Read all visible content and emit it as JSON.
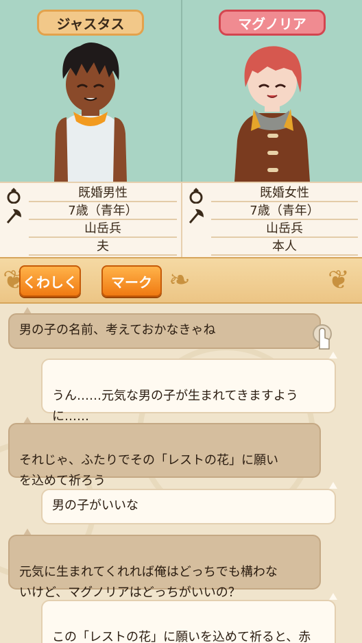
{
  "characters": {
    "left": {
      "name": "ジャスタス",
      "marital": "既婚男性",
      "age": "7歳（青年）",
      "job": "山岳兵",
      "relation": "夫",
      "badge_color": "#f2c889"
    },
    "right": {
      "name": "マグノリア",
      "marital": "既婚女性",
      "age": "7歳（青年）",
      "job": "山岳兵",
      "relation": "本人",
      "badge_color": "#f08b91"
    }
  },
  "icons": {
    "ring": "ring-icon",
    "axe": "axe-icon",
    "touch": "tap-hand-icon"
  },
  "actions": {
    "details_label": "くわしく",
    "mark_label": "マーク"
  },
  "chat": [
    {
      "speaker": "other",
      "text": "男の子の名前、考えておかなきゃね"
    },
    {
      "speaker": "self",
      "text": "うん……元気な男の子が生まれてきますよう\nに……"
    },
    {
      "speaker": "other",
      "text": "それじゃ、ふたりでその「レストの花」に願い\nを込めて祈ろう"
    },
    {
      "speaker": "self",
      "text": "男の子がいいな"
    },
    {
      "speaker": "other",
      "text": "元気に生まれてくれれば俺はどっちでも構わな\nいけど、マグノリアはどっちがいいの？"
    },
    {
      "speaker": "self",
      "text": "この「レストの花」に願いを込めて祈ると、赤\nちゃんの性別を決められるんだって……男の子"
    }
  ],
  "colors": {
    "portrait_bg": "#a9d4c4",
    "button_orange": "#f07a12",
    "bar_gold": "#ecc585"
  }
}
